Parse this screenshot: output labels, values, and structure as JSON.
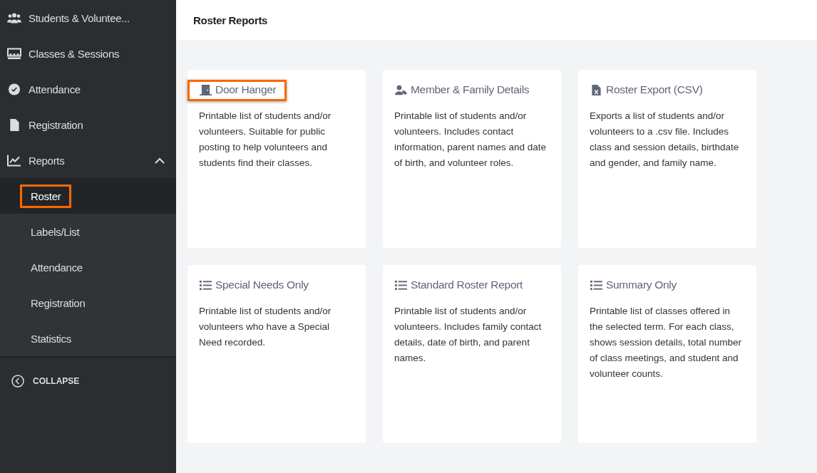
{
  "sidebar": {
    "items": [
      {
        "label": "Students & Voluntee...",
        "kind": "users"
      },
      {
        "label": "Classes & Sessions",
        "kind": "classroom"
      },
      {
        "label": "Attendance",
        "kind": "check-circle"
      },
      {
        "label": "Registration",
        "kind": "file"
      },
      {
        "label": "Reports",
        "kind": "chart",
        "expanded": true,
        "children": [
          {
            "label": "Roster",
            "selected": true,
            "highlighted": true
          },
          {
            "label": "Labels/List",
            "selected": false,
            "highlighted": false
          },
          {
            "label": "Attendance",
            "selected": false,
            "highlighted": false
          },
          {
            "label": "Registration",
            "selected": false,
            "highlighted": false
          },
          {
            "label": "Statistics",
            "selected": false,
            "highlighted": false
          }
        ]
      }
    ],
    "collapse": "COLLAPSE"
  },
  "header": {
    "title": "Roster Reports"
  },
  "cards": [
    {
      "title": "Door Hanger",
      "kind": "door",
      "highlighted": true,
      "description": "Printable list of students and/or volunteers. Suitable for public posting to help volunteers and students find their classes."
    },
    {
      "title": "Member & Family Details",
      "kind": "user-tag",
      "highlighted": false,
      "description": "Printable list of students and/or volunteers. Includes contact information, parent names and date of birth, and volunteer roles."
    },
    {
      "title": "Roster Export (CSV)",
      "kind": "file-csv",
      "highlighted": false,
      "description": "Exports a list of students and/or volunteers to a .csv file. Includes class and session details, birthdate and gender, and family name."
    },
    {
      "title": "Special Needs Only",
      "kind": "list",
      "highlighted": false,
      "description": "Printable list of students and/or volunteers who have a Special Need recorded."
    },
    {
      "title": "Standard Roster Report",
      "kind": "list",
      "highlighted": false,
      "description": "Printable list of students and/or volunteers. Includes family contact details, date of birth, and parent names."
    },
    {
      "title": "Summary Only",
      "kind": "list",
      "highlighted": false,
      "description": "Printable list of classes offered in the selected term. For each class, shows session details, total number of class meetings, and student and volunteer counts."
    }
  ]
}
